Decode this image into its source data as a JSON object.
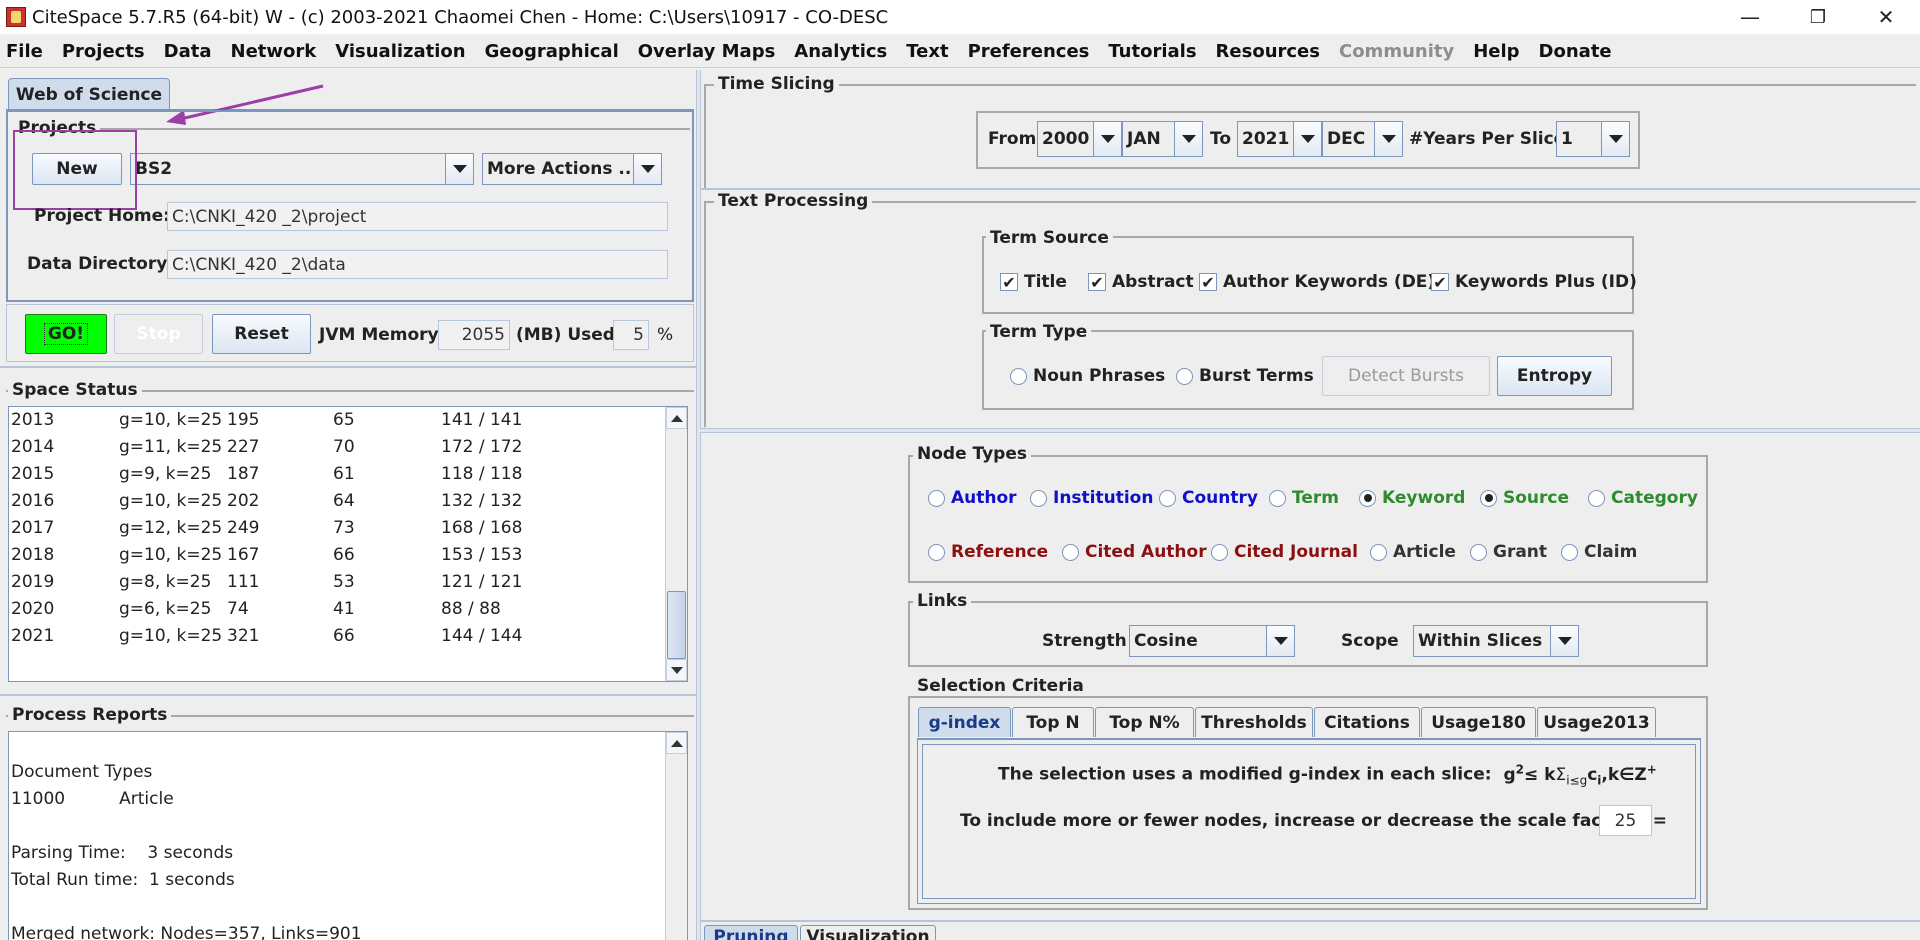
{
  "window": {
    "title": "CiteSpace 5.7.R5 (64-bit) W - (c) 2003-2021 Chaomei Chen - Home: C:\\Users\\10917 - CO-DESC",
    "minimize": "—",
    "maximize": "❐",
    "close": "✕"
  },
  "menu": [
    "File",
    "Projects",
    "Data",
    "Network",
    "Visualization",
    "Geographical",
    "Overlay Maps",
    "Analytics",
    "Text",
    "Preferences",
    "Tutorials",
    "Resources",
    "Community",
    "Help",
    "Donate"
  ],
  "menu_disabled": [
    "Community"
  ],
  "left": {
    "source_tab": "Web of Science",
    "projects_legend": "Projects",
    "new_button": "New",
    "project_name": "BS2",
    "more_actions": "More Actions ...",
    "project_home_label": "Project Home:",
    "project_home_value": "C:\\CNKI_420 _2\\project",
    "data_dir_label": "Data Directory:",
    "data_dir_value": "C:\\CNKI_420 _2\\data",
    "go_button": "GO!",
    "stop_button": "Stop",
    "reset_button": "Reset",
    "jvm_label": "JVM Memory",
    "jvm_value": "2055",
    "mb_used_label": "(MB) Used",
    "used_value": "5",
    "percent": "%",
    "space_status_legend": "Space Status",
    "space_status_rows": [
      [
        "2013",
        "g=10, k=25",
        "195",
        "65",
        "141 / 141"
      ],
      [
        "2014",
        "g=11, k=25",
        "227",
        "70",
        "172 / 172"
      ],
      [
        "2015",
        "g=9, k=25",
        "187",
        "61",
        "118 / 118"
      ],
      [
        "2016",
        "g=10, k=25",
        "202",
        "64",
        "132 / 132"
      ],
      [
        "2017",
        "g=12, k=25",
        "249",
        "73",
        "168 / 168"
      ],
      [
        "2018",
        "g=10, k=25",
        "167",
        "66",
        "153 / 153"
      ],
      [
        "2019",
        "g=8, k=25",
        "111",
        "53",
        "121 / 121"
      ],
      [
        "2020",
        "g=6, k=25",
        "74",
        "41",
        "88 / 88"
      ],
      [
        "2021",
        "g=10, k=25",
        "321",
        "66",
        "144 / 144"
      ]
    ],
    "process_reports_legend": "Process Reports",
    "report_lines": [
      "",
      "Document Types",
      "11000          Article",
      "",
      "Parsing Time:    3 seconds",
      "Total Run time:  1 seconds",
      "",
      "Merged network: Nodes=357, Links=901"
    ]
  },
  "time_slicing": {
    "legend": "Time Slicing",
    "from_label": "From",
    "from_year": "2000",
    "from_month": "JAN",
    "to_label": "To",
    "to_year": "2021",
    "to_month": "DEC",
    "years_per_slice_label": "#Years Per Slice",
    "years_per_slice": "1"
  },
  "text_processing": {
    "legend": "Text Processing",
    "term_source_legend": "Term Source",
    "sources": [
      {
        "label": "Title",
        "checked": true
      },
      {
        "label": "Abstract",
        "checked": true
      },
      {
        "label": "Author Keywords (DE)",
        "checked": true
      },
      {
        "label": "Keywords Plus (ID)",
        "checked": true
      }
    ],
    "term_type_legend": "Term Type",
    "noun_phrases": "Noun Phrases",
    "burst_terms": "Burst Terms",
    "detect_bursts": "Detect Bursts",
    "entropy": "Entropy"
  },
  "node_types": {
    "legend": "Node Types",
    "row1": [
      {
        "label": "Author",
        "selected": false,
        "color": "#1010c8"
      },
      {
        "label": "Institution",
        "selected": false,
        "color": "#1010c8"
      },
      {
        "label": "Country",
        "selected": false,
        "color": "#1010c8"
      },
      {
        "label": "Term",
        "selected": false,
        "color": "#2e8b2e"
      },
      {
        "label": "Keyword",
        "selected": true,
        "color": "#2e8b2e"
      },
      {
        "label": "Source",
        "selected": true,
        "color": "#2e8b2e"
      },
      {
        "label": "Category",
        "selected": false,
        "color": "#2e8b2e"
      }
    ],
    "row2": [
      {
        "label": "Reference",
        "selected": false,
        "color": "#8b1010"
      },
      {
        "label": "Cited Author",
        "selected": false,
        "color": "#8b1010"
      },
      {
        "label": "Cited Journal",
        "selected": false,
        "color": "#8b1010"
      },
      {
        "label": "Article",
        "selected": false,
        "color": "#333333"
      },
      {
        "label": "Grant",
        "selected": false,
        "color": "#333333"
      },
      {
        "label": "Claim",
        "selected": false,
        "color": "#333333"
      }
    ]
  },
  "links": {
    "legend": "Links",
    "strength_label": "Strength",
    "strength_value": "Cosine",
    "scope_label": "Scope",
    "scope_value": "Within Slices"
  },
  "selection": {
    "legend": "Selection Criteria",
    "tabs": [
      "g-index",
      "Top N",
      "Top N%",
      "Thresholds",
      "Citations",
      "Usage180",
      "Usage2013"
    ],
    "active_tab": "g-index",
    "description": "The selection uses a modified g-index in each slice:",
    "formula_g": "g",
    "formula_sup2": "2",
    "formula_mid": "≤ k",
    "formula_sigma": "Σ",
    "formula_sub": "i≤g",
    "formula_ci": "c",
    "formula_ci_sub": "i",
    "formula_tail": ",k∈Z",
    "formula_plus": "+",
    "scale_text": "To include more or fewer nodes, increase or decrease the scale factor k =",
    "k_value": "25"
  },
  "bottom_tabs": [
    "Pruning",
    "Visualization"
  ]
}
